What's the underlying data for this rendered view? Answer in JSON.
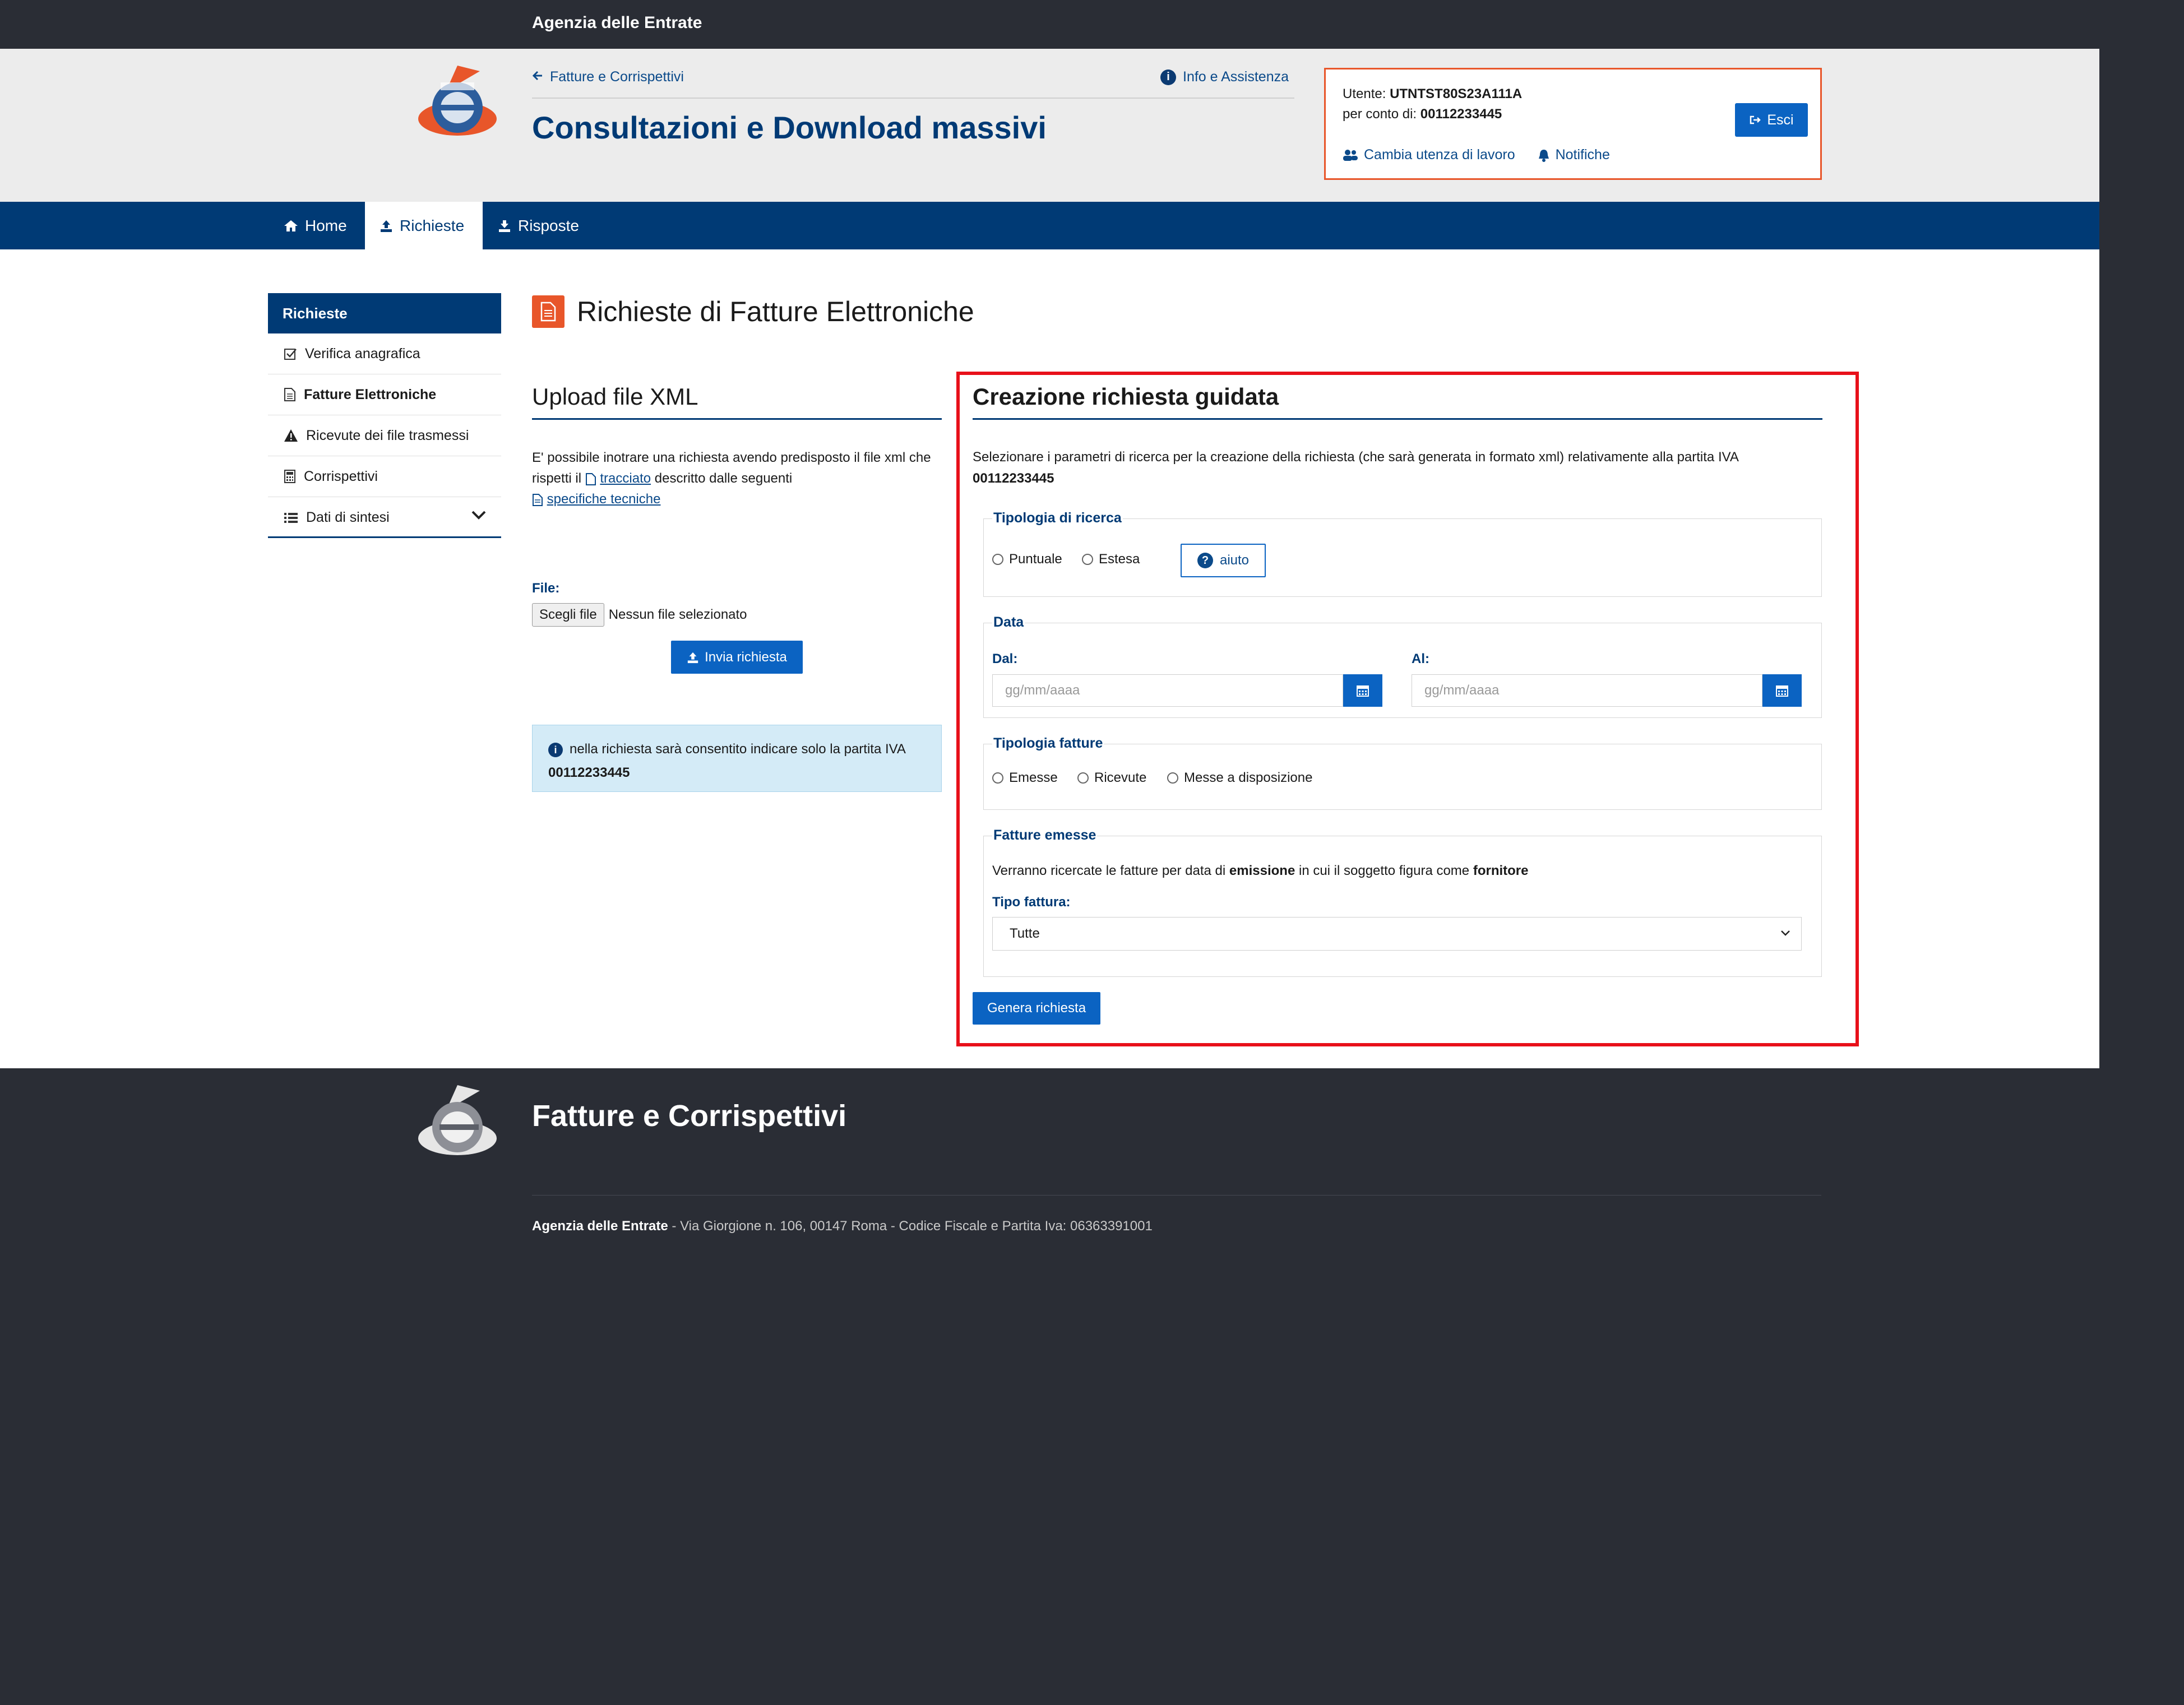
{
  "topbar": {
    "brand": "Agenzia delle Entrate"
  },
  "header": {
    "back_link": "Fatture e Corrispettivi",
    "info_link": "Info e Assistenza",
    "title": "Consultazioni e Download massivi"
  },
  "user": {
    "utente_label": "Utente:",
    "utente_value": "UTNTST80S23A111A",
    "conto_label": "per conto di:",
    "conto_value": "00112233445",
    "cambia": "Cambia utenza di lavoro",
    "notifiche": "Notifiche",
    "esci": "Esci"
  },
  "nav": {
    "home": "Home",
    "richieste": "Richieste",
    "risposte": "Risposte"
  },
  "sidebar": {
    "header": "Richieste",
    "items": [
      {
        "label": "Verifica anagrafica"
      },
      {
        "label": "Fatture Elettroniche"
      },
      {
        "label": "Ricevute dei file trasmessi"
      },
      {
        "label": "Corrispettivi"
      },
      {
        "label": "Dati di sintesi"
      }
    ]
  },
  "main": {
    "heading": "Richieste di Fatture Elettroniche",
    "upload": {
      "title": "Upload file XML",
      "text_1": "E' possibile inotrare una richiesta avendo predisposto il file xml che rispetti il",
      "tracciato": "tracciato",
      "text_2": "descritto dalle seguenti",
      "specifiche": "specifiche tecniche",
      "file_label": "File:",
      "file_button": "Scegli file",
      "file_status": "Nessun file selezionato",
      "send": "Invia richiesta",
      "notice_text": "nella richiesta sarà consentito indicare solo la partita IVA",
      "notice_piva": "00112233445"
    },
    "guided": {
      "title": "Creazione richiesta guidata",
      "intro": "Selezionare i parametri di ricerca per la creazione della richiesta (che sarà generata in formato xml) relativamente alla partita IVA",
      "piva": "00112233445",
      "tipologia_ricerca": {
        "legend": "Tipologia di ricerca",
        "puntuale": "Puntuale",
        "estesa": "Estesa",
        "aiuto": "aiuto"
      },
      "data": {
        "legend": "Data",
        "dal_label": "Dal:",
        "al_label": "Al:",
        "placeholder": "gg/mm/aaaa"
      },
      "tipologia_fatture": {
        "legend": "Tipologia fatture",
        "emesse": "Emesse",
        "ricevute": "Ricevute",
        "disposizione": "Messe a disposizione"
      },
      "fatture_emesse": {
        "legend": "Fatture emesse",
        "text_1": "Verranno ricercate le fatture per data di",
        "emissione": "emissione",
        "text_2": "in cui il soggetto figura come",
        "fornitore": "fornitore",
        "tipo_label": "Tipo fattura:",
        "tipo_value": "Tutte"
      },
      "generate": "Genera richiesta"
    }
  },
  "footer": {
    "title": "Fatture e Corrispettivi",
    "org": "Agenzia delle Entrate",
    "address": "- Via Giorgione n. 106, 00147 Roma - Codice Fiscale e Partita Iva: 06363391001"
  },
  "colors": {
    "brand_blue": "#003a75",
    "button_blue": "#0b63c2",
    "accent_orange": "#e8562a",
    "highlight_red": "#e8101a"
  }
}
